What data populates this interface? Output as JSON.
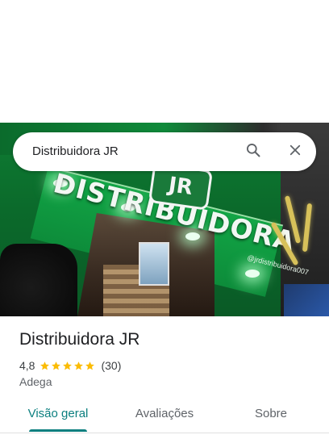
{
  "search": {
    "query": "Distribuidora JR",
    "search_icon": "search-icon",
    "close_icon": "close-icon"
  },
  "photo": {
    "sign_text": "DISTRIBUIDORA",
    "logo_text": "JR",
    "instagram_handle": "@jrdistribuidora007"
  },
  "place": {
    "name": "Distribuidora JR",
    "rating": "4,8",
    "rating_stars": 5,
    "review_count": "(30)",
    "category": "Adega"
  },
  "tabs": [
    {
      "label": "Visão geral",
      "active": true
    },
    {
      "label": "Avaliações",
      "active": false
    },
    {
      "label": "Sobre",
      "active": false
    }
  ],
  "colors": {
    "accent": "#0b7f7f",
    "star": "#fbbc04",
    "sign_green": "#12a646"
  }
}
